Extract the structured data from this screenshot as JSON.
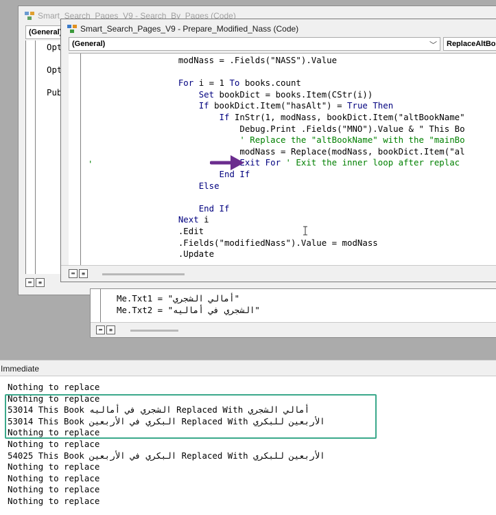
{
  "back_window": {
    "title": "Smart_Search_Pages_V9 - Search_By_Pages (Code)",
    "object_combo": "(General)",
    "code_lines": [
      "Opt",
      "Opt",
      "Pub"
    ]
  },
  "middle_window": {
    "code_lines": [
      "Me.Txt1 = \"أمالي الشجري\"",
      "Me.Txt2 = \"الشجري في أماليه\""
    ]
  },
  "front_window": {
    "title": "Smart_Search_Pages_V9 - Prepare_Modified_Nass (Code)",
    "object_combo": "(General)",
    "procedure_combo": "ReplaceAltBo",
    "margin_marker": "'",
    "code_lines": [
      [
        {
          "t": "    modNass = .Fields(\"NASS\").Value",
          "c": "n"
        }
      ],
      [
        {
          "t": "",
          "c": "n"
        }
      ],
      [
        {
          "t": "    ",
          "c": "n"
        },
        {
          "t": "For",
          "c": "k"
        },
        {
          "t": " i = 1 ",
          "c": "n"
        },
        {
          "t": "To",
          "c": "k"
        },
        {
          "t": " books.count",
          "c": "n"
        }
      ],
      [
        {
          "t": "        ",
          "c": "n"
        },
        {
          "t": "Set",
          "c": "k"
        },
        {
          "t": " bookDict = books.Item(CStr(i))",
          "c": "n"
        }
      ],
      [
        {
          "t": "        ",
          "c": "n"
        },
        {
          "t": "If",
          "c": "k"
        },
        {
          "t": " bookDict.Item(\"hasAlt\") = ",
          "c": "n"
        },
        {
          "t": "True Then",
          "c": "k"
        }
      ],
      [
        {
          "t": "            ",
          "c": "n"
        },
        {
          "t": "If",
          "c": "k"
        },
        {
          "t": " InStr(1, modNass, bookDict.Item(\"altBookName\"",
          "c": "n"
        }
      ],
      [
        {
          "t": "                Debug.Print .Fields(\"MNO\").Value & \" This Bo",
          "c": "n"
        }
      ],
      [
        {
          "t": "                ' Replace the \"altBookName\" with the \"mainBo",
          "c": "c"
        }
      ],
      [
        {
          "t": "                modNass = Replace(modNass, bookDict.Item(\"al",
          "c": "n"
        }
      ],
      [
        {
          "t": "                ",
          "c": "n"
        },
        {
          "t": "Exit For",
          "c": "k"
        },
        {
          "t": " ' Exit the inner loop after replac",
          "c": "c"
        }
      ],
      [
        {
          "t": "            ",
          "c": "n"
        },
        {
          "t": "End If",
          "c": "k"
        }
      ],
      [
        {
          "t": "        ",
          "c": "n"
        },
        {
          "t": "Else",
          "c": "k"
        }
      ],
      [
        {
          "t": "",
          "c": "n"
        }
      ],
      [
        {
          "t": "        ",
          "c": "n"
        },
        {
          "t": "End If",
          "c": "k"
        }
      ],
      [
        {
          "t": "    ",
          "c": "n"
        },
        {
          "t": "Next",
          "c": "k"
        },
        {
          "t": " i",
          "c": "n"
        }
      ],
      [
        {
          "t": "    .Edit",
          "c": "n"
        }
      ],
      [
        {
          "t": "    .Fields(\"modifiedNass\").Value = modNass",
          "c": "n"
        }
      ],
      [
        {
          "t": "    .Update",
          "c": "n"
        }
      ]
    ]
  },
  "immediate": {
    "title": "Immediate",
    "lines": [
      "Nothing to replace",
      "Nothing to replace",
      "53014 This Book الشجري في أماليه Replaced With أمالي الشجري",
      "53014 This Book البكري في الأربعين Replaced With الأربعين للبكري",
      "Nothing to replace",
      "Nothing to replace",
      "54025 This Book البكري في الأربعين Replaced With الأربعين للبكري",
      "Nothing to replace",
      "Nothing to replace",
      "Nothing to replace",
      "Nothing to replace"
    ]
  },
  "icons": [
    "vba-project-icon",
    "arrow-right-icon",
    "text-cursor-icon",
    "view-procedure-icon",
    "view-module-icon"
  ],
  "colors": {
    "keyword": "#00007f",
    "comment": "#008000",
    "arrow": "#6b2d8e",
    "highlight_box": "#3aa88a"
  }
}
